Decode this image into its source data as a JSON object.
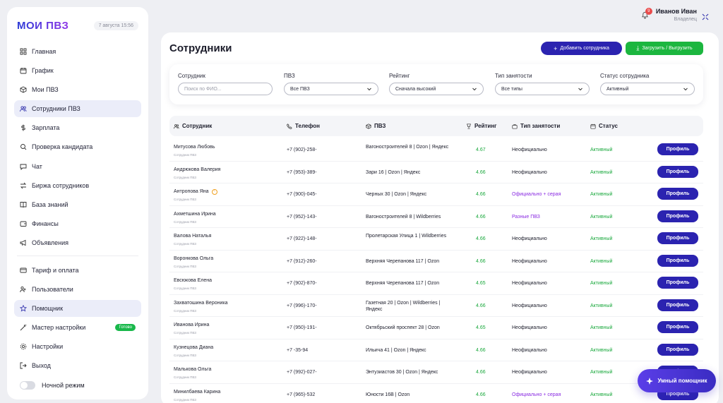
{
  "brand": {
    "logo": "МОИ ПВЗ",
    "date": "7 августа 15:56"
  },
  "nav": {
    "primary": [
      {
        "label": "Главная",
        "icon": "grid-icon",
        "active": false
      },
      {
        "label": "График",
        "icon": "calendar-icon",
        "active": false
      },
      {
        "label": "Мои ПВЗ",
        "icon": "box-icon",
        "active": false
      },
      {
        "label": "Сотрудники ПВЗ",
        "icon": "users-icon",
        "active": true
      },
      {
        "label": "Зарплата",
        "icon": "dollar-icon",
        "active": false
      },
      {
        "label": "Проверка кандидата",
        "icon": "search-icon",
        "active": false
      },
      {
        "label": "Чат",
        "icon": "chat-icon",
        "active": false
      },
      {
        "label": "Биржа сотрудников",
        "icon": "exchange-icon",
        "active": false
      },
      {
        "label": "База знаний",
        "icon": "book-icon",
        "active": false
      },
      {
        "label": "Финансы",
        "icon": "wallet-icon",
        "active": false
      },
      {
        "label": "Объявления",
        "icon": "megaphone-icon",
        "active": false
      }
    ],
    "secondary": [
      {
        "label": "Тариф и оплата",
        "icon": "card-icon",
        "active": false,
        "badge": ""
      },
      {
        "label": "Пользователи",
        "icon": "user-group-icon",
        "active": false,
        "badge": ""
      },
      {
        "label": "Помощник",
        "icon": "star-icon",
        "active": true,
        "badge": ""
      },
      {
        "label": "Мастер настройки",
        "icon": "wand-icon",
        "active": false,
        "badge": "Готово"
      },
      {
        "label": "Настройки",
        "icon": "gear-icon",
        "active": false,
        "badge": ""
      },
      {
        "label": "Выход",
        "icon": "logout-icon",
        "active": false,
        "badge": ""
      }
    ],
    "night_mode": "Ночной режим"
  },
  "user": {
    "name": "Иванов Иван",
    "role": "Владелец",
    "notifications": "9"
  },
  "page": {
    "title": "Сотрудники",
    "add_button": "Добавить сотрудника",
    "load_button": "Загрузить / Выгрузить"
  },
  "filters": [
    {
      "label": "Сотрудник",
      "value": "",
      "placeholder": "Поиск по ФИО...",
      "dropdown": false
    },
    {
      "label": "ПВЗ",
      "value": "Все ПВЗ",
      "placeholder": "",
      "dropdown": true
    },
    {
      "label": "Рейтинг",
      "value": "Сначала высокий",
      "placeholder": "",
      "dropdown": true
    },
    {
      "label": "Тип занятости",
      "value": "Все типы",
      "placeholder": "",
      "dropdown": true
    },
    {
      "label": "Статус сотрудника",
      "value": "Активный",
      "placeholder": "",
      "dropdown": true
    }
  ],
  "table": {
    "headers": [
      "Сотрудник",
      "Телефон",
      "ПВЗ",
      "Рейтинг",
      "Тип занятости",
      "Статус"
    ],
    "profile_label": "Профиль",
    "rows": [
      {
        "name": "Митусова Любовь",
        "role": "Сотрудник ПВЗ",
        "phone": "+7 (902)-258-",
        "pvz": "Вагоностроителей 8 | Ozon | Яндекс",
        "rating": "4.67",
        "type": "Неофициально",
        "type_purple": false,
        "status": "Активный",
        "warn": false
      },
      {
        "name": "Андрюкова Валерия",
        "role": "Сотрудник ПВЗ",
        "phone": "+7 (953)-389-",
        "pvz": "Зари 16 | Ozon | Яндекс",
        "rating": "4.66",
        "type": "Неофициально",
        "type_purple": false,
        "status": "Активный",
        "warn": false
      },
      {
        "name": "Антропова Яна",
        "role": "Сотрудник ПВЗ",
        "phone": "+7 (900)-045-",
        "pvz": "Черных 30 | Ozon | Яндекс",
        "rating": "4.66",
        "type": "Официально + серая",
        "type_purple": true,
        "status": "Активный",
        "warn": true
      },
      {
        "name": "Ахметшина Ирина",
        "role": "Сотрудник ПВЗ",
        "phone": "+7 (952)-143-",
        "pvz": "Вагоностроителей 8 | Wildberries",
        "rating": "4.66",
        "type": "Разные ПВЗ",
        "type_purple": true,
        "status": "Активный",
        "warn": false
      },
      {
        "name": "Валова Наталья",
        "role": "Сотрудник ПВЗ",
        "phone": "+7 (922)-148-",
        "pvz": "Пролетарская Улица 1 | Wildberries",
        "rating": "4.66",
        "type": "Неофициально",
        "type_purple": false,
        "status": "Активный",
        "warn": false
      },
      {
        "name": "Воронкова Ольга",
        "role": "Сотрудник ПВЗ",
        "phone": "+7 (912)-260-",
        "pvz": "Верхняя Черепанова 117 | Ozon",
        "rating": "4.66",
        "type": "Неофициально",
        "type_purple": false,
        "status": "Активный",
        "warn": false
      },
      {
        "name": "Евсюкова Елена",
        "role": "Сотрудник ПВЗ",
        "phone": "+7 (902)-870-",
        "pvz": "Верхняя Черепанова 117 | Ozon",
        "rating": "4.65",
        "type": "Неофициально",
        "type_purple": false,
        "status": "Активный",
        "warn": false
      },
      {
        "name": "Захватошина Вероника",
        "role": "Сотрудник ПВЗ",
        "phone": "+7 (996)-170-",
        "pvz": "Газетная 20 | Ozon | Wildberries | Яндекс",
        "rating": "4.66",
        "type": "Неофициально",
        "type_purple": false,
        "status": "Активный",
        "warn": false
      },
      {
        "name": "Иванова Ирина",
        "role": "Сотрудник ПВЗ",
        "phone": "+7 (950)-191-",
        "pvz": "Октябрьский проспект 28 | Ozon",
        "rating": "4.65",
        "type": "Неофициально",
        "type_purple": false,
        "status": "Активный",
        "warn": false
      },
      {
        "name": "Кузнецова Диана",
        "role": "Сотрудник ПВЗ",
        "phone": "+7                -35-94",
        "pvz": "Ильича 41 | Ozon | Яндекс",
        "rating": "4.66",
        "type": "Неофициально",
        "type_purple": false,
        "status": "Активный",
        "warn": false
      },
      {
        "name": "Малькова Ольга",
        "role": "Сотрудник ПВЗ",
        "phone": "+7 (992)-027-",
        "pvz": "Энтузиастов 30 | Ozon | Яндекс",
        "rating": "4.66",
        "type": "Неофициально",
        "type_purple": false,
        "status": "Активный",
        "warn": false
      },
      {
        "name": "Минилбаева Карина",
        "role": "Сотрудник ПВЗ",
        "phone": "+7 (965)-532",
        "pvz": "Юности 16В | Ozon",
        "rating": "4.66",
        "type": "Официально + серая",
        "type_purple": true,
        "status": "Активный",
        "warn": false
      }
    ]
  },
  "assistant_button": "Умный помощник"
}
